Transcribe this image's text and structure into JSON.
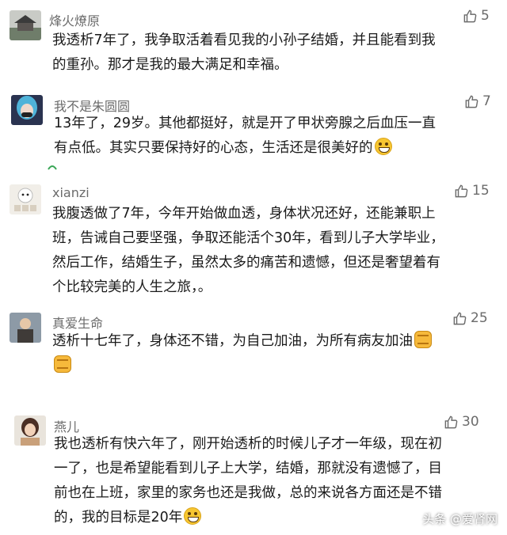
{
  "accent_color": "#6b6b6b",
  "comments": [
    {
      "username": "烽火燎原",
      "likes": "5",
      "lines": [
        "我透析7年了，我争取活着看见我的小孙子结婚，并且能看到我",
        "的重孙。那才是我的最大满足和幸福。"
      ]
    },
    {
      "username": "我不是朱圆圆",
      "likes": "7",
      "lines": [
        "13年了，29岁。其他都挺好，就是开了甲状旁腺之后血压一直",
        "有点低。其实只要保持好的心态，生活还是很美好的"
      ]
    },
    {
      "username": "xianzi",
      "likes": "15",
      "lines": [
        "我腹透做了7年，今年开始做血透，身体状况还好，还能兼职上",
        "班，告诫自己要坚强，争取还能活个30年，看到儿子大学毕业，",
        "然后工作，结婚生子，虽然太多的痛苦和遗憾，但还是奢望着有",
        "个比较完美的人生之旅，。"
      ]
    },
    {
      "username": "真爱生命",
      "likes": "25",
      "lines": [
        "透析十七年了，身体还不错，为自己加油，为所有病友加油",
        ""
      ]
    },
    {
      "username": "燕儿",
      "likes": "30",
      "lines": [
        "我也透析有快六年了，刚开始透析的时候儿子才一年级，现在初",
        "一了，也是希望能看到儿子上大学，结婚，那就没有遗憾了，目",
        "前也在上班，家里的家务也还是我做，总的来说各方面还是不错",
        "的，我的目标是20年"
      ]
    }
  ],
  "watermark": "头条 @爱肾网",
  "icons": {
    "like": "thumbs-up-icon",
    "grin": "grinning-face-emoji",
    "fist": "raised-fist-emoji"
  }
}
